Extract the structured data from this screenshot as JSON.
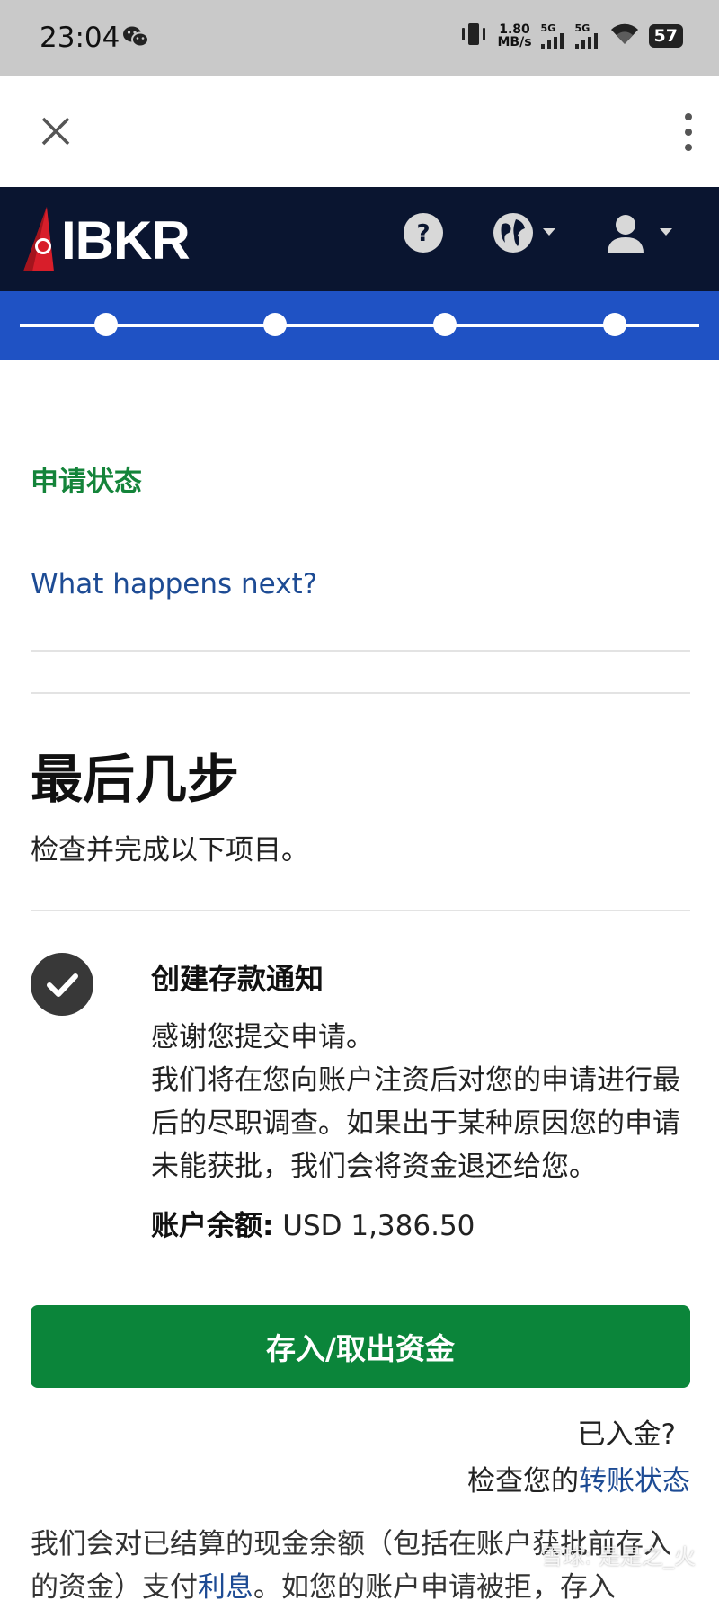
{
  "status_bar": {
    "time": "23:04",
    "network_speed_value": "1.80",
    "network_speed_unit": "MB/s",
    "signal1_label": "5G",
    "signal2_label": "5G",
    "battery": "57"
  },
  "brand": {
    "logo_text": "IBKR",
    "header_bg": "#0a1530",
    "progress_bg": "#1f52c4",
    "progress_steps": 4
  },
  "page": {
    "status_title": "申请状态",
    "what_next_link": "What happens next?",
    "heading": "最后几步",
    "subheading": "检查并完成以下项目。"
  },
  "task": {
    "title": "创建存款通知",
    "body_line1": "感谢您提交申请。",
    "body_line2": "我们将在您向账户注资后对您的申请进行最后的尽职调查。如果出于某种原因您的申请未能获批，我们会将资金退还给您。",
    "balance_label": "账户余额:",
    "balance_value": " USD 1,386.50",
    "button_label": "存入/取出资金",
    "accent": "#0b853a"
  },
  "funded": {
    "question": "已入金?",
    "check_prefix": "检查您的",
    "check_link": "转账状态"
  },
  "bottom": {
    "text_part1": "我们会对已结算的现金余额（包括在账户获批前存入的资金）支付",
    "interest_link": "利息",
    "text_part2": "。如您的账户申请被拒，存入"
  },
  "watermark": "雪球: 是是之_火"
}
